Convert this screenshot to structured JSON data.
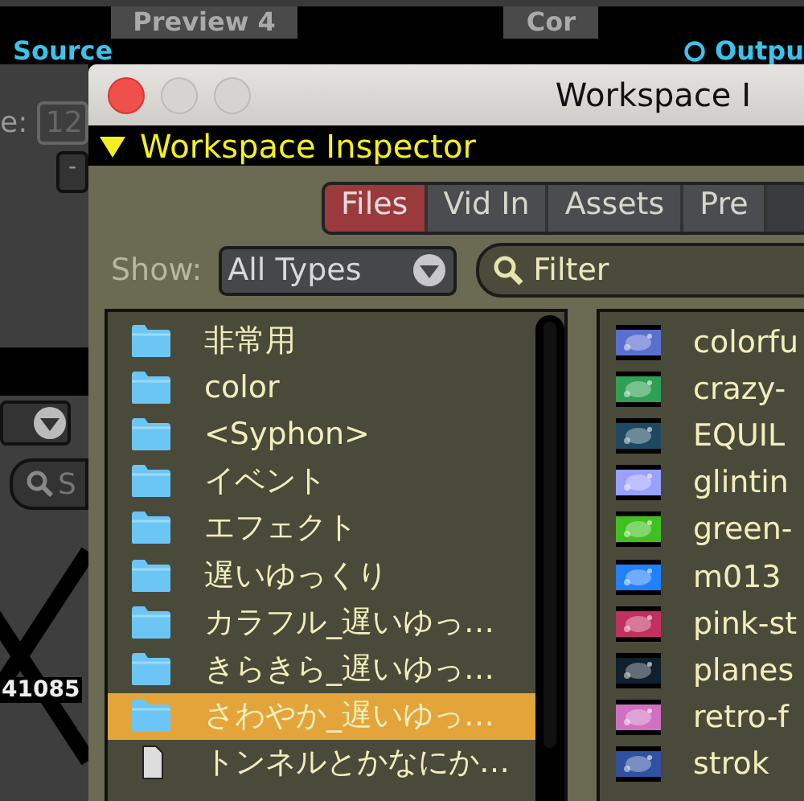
{
  "background": {
    "tabs": [
      {
        "label": "Preview 4"
      },
      {
        "label": "Cor"
      }
    ],
    "source_label": "Source",
    "output_label": "Outpu",
    "field_label": "e:",
    "field_value": "12",
    "minus_button": "-",
    "search_placeholder": "S",
    "id_text": "41085"
  },
  "window": {
    "title": "Workspace I",
    "section": {
      "title": "Workspace Inspector",
      "expanded": true
    },
    "tabs": [
      {
        "label": "Files",
        "selected": true
      },
      {
        "label": "Vid In",
        "selected": false
      },
      {
        "label": "Assets",
        "selected": false
      },
      {
        "label": "Pre",
        "selected": false
      }
    ],
    "show_label": "Show:",
    "type_select": "All Types",
    "filter_placeholder": "Filter",
    "files": [
      {
        "name": "非常用",
        "kind": "folder",
        "selected": false
      },
      {
        "name": "color",
        "kind": "folder",
        "selected": false
      },
      {
        "name": "<Syphon>",
        "kind": "folder",
        "selected": false
      },
      {
        "name": "イベント",
        "kind": "folder",
        "selected": false
      },
      {
        "name": "エフェクト",
        "kind": "folder",
        "selected": false
      },
      {
        "name": "遅いゆっくり",
        "kind": "folder",
        "selected": false
      },
      {
        "name": "カラフル_遅いゆっ…",
        "kind": "folder",
        "selected": false
      },
      {
        "name": "きらきら_遅いゆっ…",
        "kind": "folder",
        "selected": false
      },
      {
        "name": "さわやか_遅いゆっ…",
        "kind": "folder",
        "selected": true
      },
      {
        "name": "トンネルとかなにか…",
        "kind": "file",
        "selected": false
      }
    ],
    "media": [
      {
        "name": "colorfu",
        "color": "#5a6fd0"
      },
      {
        "name": "crazy-",
        "color": "#2fa055"
      },
      {
        "name": "EQUIL",
        "color": "#1d4a60"
      },
      {
        "name": "glintin",
        "color": "#9aa0ff"
      },
      {
        "name": "green-",
        "color": "#3fc020"
      },
      {
        "name": "m013",
        "color": "#2080ff"
      },
      {
        "name": "pink-st",
        "color": "#c03060"
      },
      {
        "name": "planes",
        "color": "#10202e"
      },
      {
        "name": "retro-f",
        "color": "#d070c0"
      },
      {
        "name": "strok",
        "color": "#3050a0"
      }
    ]
  }
}
